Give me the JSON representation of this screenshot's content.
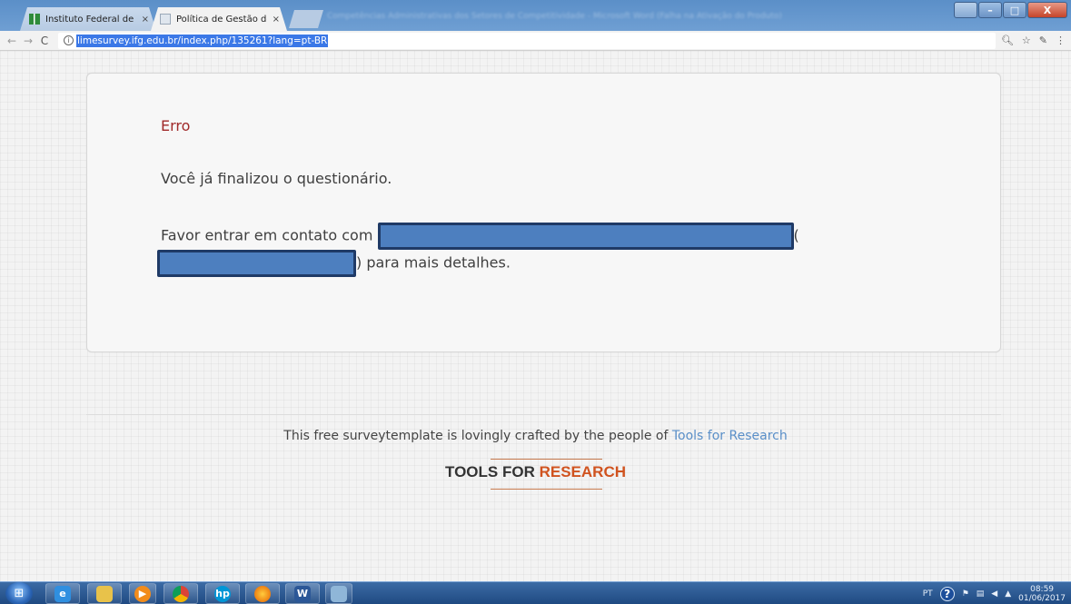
{
  "browser": {
    "tabs": [
      {
        "title": "Instituto Federal de Goiá",
        "active": false,
        "close": "×"
      },
      {
        "title": "Política de Gestão de Pe",
        "active": true,
        "close": "×"
      }
    ],
    "window_title": "Competências Administrativas dos Setores de Competitividade - Microsoft Word (Falha na Ativação do Produto)",
    "window_controls": {
      "minimize": "–",
      "maximize": "□",
      "close": "X"
    },
    "nav": {
      "back": "←",
      "forward": "→",
      "reload": "C"
    },
    "url": "limesurvey.ifg.edu.br/index.php/135261?lang=pt-BR",
    "toolbar_icons": [
      "zoom-icon",
      "star-icon",
      "pen-icon",
      "menu-icon"
    ]
  },
  "page": {
    "error_title": "Erro",
    "error_message": "Você já finalizou o questionário.",
    "contact_prefix": "Favor entrar em contato com",
    "contact_open_paren": "(",
    "contact_suffix": ") para mais detalhes.",
    "footer_text": "This free surveytemplate is lovingly crafted by the people of",
    "footer_link": "Tools for Research",
    "logo_part1": "TOOLS FOR",
    "logo_part2": "RESEARCH"
  },
  "colors": {
    "error_title": "#a02a2a",
    "link": "#5a8fc8",
    "logo_accent": "#d0531f",
    "redaction_fill": "#4d7fbf",
    "redaction_border": "#1f3a66"
  },
  "taskbar": {
    "apps": [
      "ie-icon",
      "explorer-icon",
      "media-icon",
      "chrome-icon",
      "hp-icon",
      "firefox-icon",
      "word-icon",
      "app-icon"
    ],
    "language": "PT",
    "time": "08:59",
    "date": "01/06/2017"
  }
}
